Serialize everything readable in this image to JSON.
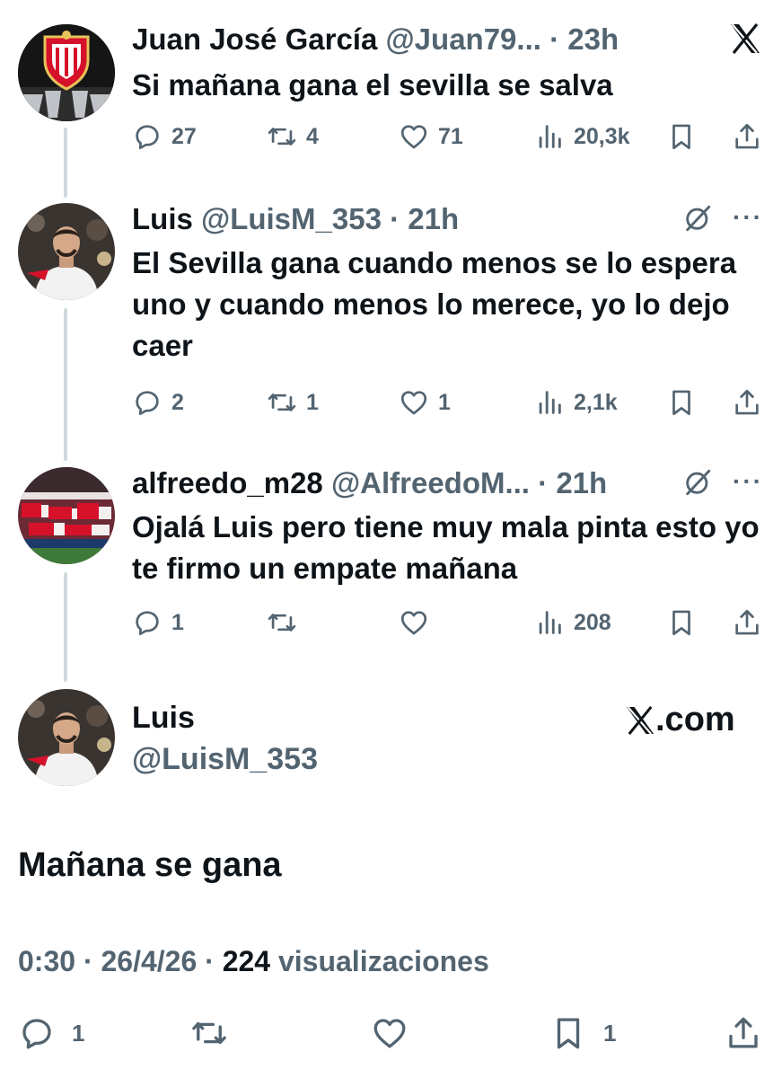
{
  "colors": {
    "text_primary": "#0f1419",
    "text_secondary": "#536471",
    "thread_line": "#cfd9de",
    "sevilla_red": "#d6112a"
  },
  "tweet1": {
    "name": "Juan José García",
    "handle": "@Juan79...",
    "time": "· 23h",
    "text": "Si mañana gana el sevilla se salva",
    "stats": {
      "replies": "27",
      "retweets": "4",
      "likes": "71",
      "views": "20,3k"
    }
  },
  "tweet2": {
    "name": "Luis",
    "handle": "@LuisM_353",
    "time": "· 21h",
    "text": "El Sevilla gana cuando menos se lo espera uno y cuando menos lo merece, yo lo dejo caer",
    "stats": {
      "replies": "2",
      "retweets": "1",
      "likes": "1",
      "views": "2,1k"
    }
  },
  "tweet3": {
    "name": "alfreedo_m28",
    "handle": "@AlfreedoM...",
    "time": "· 21h",
    "text": "Ojalá Luis pero tiene muy mala pinta esto yo te firmo un empate mañana",
    "stats": {
      "replies": "1",
      "retweets": "",
      "likes": "",
      "views": "208"
    }
  },
  "main": {
    "name": "Luis",
    "handle": "@LuisM_353",
    "brand": ".com",
    "text": "Mañana se gana",
    "time": "0:30 · 26/4/26 · ",
    "views_count": "224",
    "views_label": " visualizaciones",
    "stats": {
      "replies": "1",
      "retweets": "",
      "likes": "",
      "bookmarks": "1"
    }
  },
  "icons": [
    "x-logo-icon",
    "reply-icon",
    "retweet-icon",
    "like-icon",
    "views-icon",
    "bookmark-icon",
    "share-icon",
    "grok-icon",
    "more-icon"
  ]
}
